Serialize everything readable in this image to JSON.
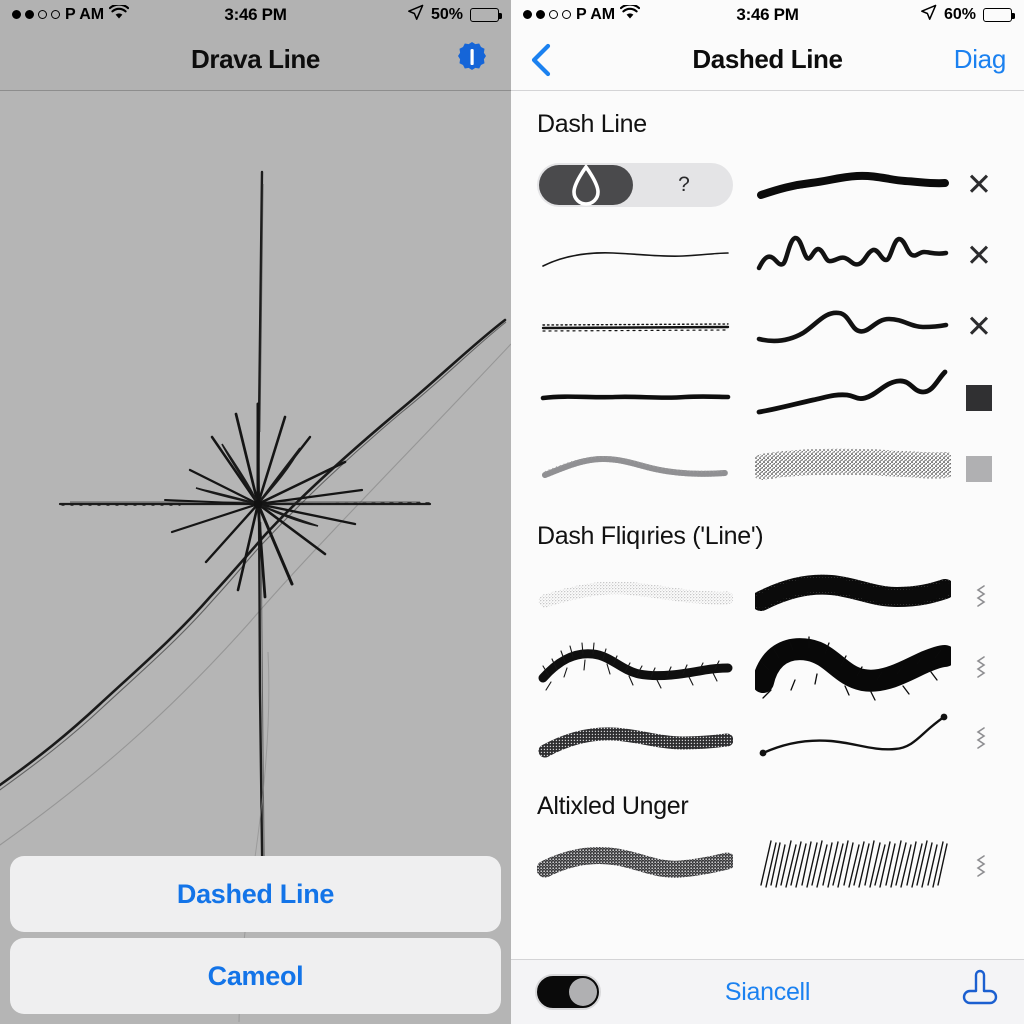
{
  "left": {
    "status_bar": {
      "signal_dots": [
        "filled",
        "filled",
        "empty",
        "empty"
      ],
      "carrier": "P AM",
      "wifi_icon": "wifi-icon",
      "time": "3:46 PM",
      "location_icon": "location-arrow-icon",
      "battery_percent": "50%",
      "battery_icon": "battery-icon"
    },
    "nav": {
      "title": "Drava Line",
      "right_icon": "info-badge-icon"
    },
    "canvas": {
      "name": "drawing-canvas",
      "background_color": "#b5b5b5",
      "description": "starburst crosshair sketch"
    },
    "actions": [
      {
        "label": "Dashed Line",
        "name": "dashed-line-button"
      },
      {
        "label": "Cameol",
        "name": "cancel-button"
      }
    ]
  },
  "right": {
    "status_bar": {
      "signal_dots": [
        "filled",
        "filled",
        "empty",
        "empty"
      ],
      "carrier": "P AM",
      "wifi_icon": "wifi-icon",
      "time": "3:46 PM",
      "location_icon": "location-arrow-icon",
      "battery_percent": "60%",
      "battery_icon": "battery-icon"
    },
    "nav": {
      "back_icon": "chevron-left-icon",
      "title": "Dashed Line",
      "action_label": "Diag"
    },
    "sections": [
      {
        "title": "Dash Line",
        "name": "section-dash-line",
        "rows": [
          {
            "left": "segmented-control",
            "right": "thick-tapered-stroke",
            "mark": "x",
            "mark_label": "✕"
          },
          {
            "left": "thin-wavy-stroke",
            "right": "jagged-zigzag-stroke",
            "mark": "x",
            "mark_label": "✕"
          },
          {
            "left": "dotted-flat-stroke",
            "right": "smooth-curve-stroke",
            "mark": "x",
            "mark_label": "✕"
          },
          {
            "left": "bold-flat-stroke",
            "right": "rising-wave-stroke",
            "mark": "swatch",
            "mark_color": "#303032"
          },
          {
            "left": "light-textured-stroke",
            "right": "spray-dots-stroke",
            "mark": "swatch",
            "mark_color": "#b0b0b2"
          }
        ],
        "segmented_control": {
          "name": "brush-mode-segmented-control",
          "options": [
            {
              "label": "☁",
              "icon": "droplet-icon",
              "selected": true
            },
            {
              "label": "?",
              "icon": "question-icon",
              "selected": false
            }
          ]
        }
      },
      {
        "title": "Dash Fliqıries ('Line')",
        "name": "section-dash-figures",
        "rows": [
          {
            "left": "light-speckle-stroke",
            "right": "dense-furry-stroke",
            "mark": "squiggle"
          },
          {
            "left": "bristle-brush-stroke",
            "right": "heavy-fur-stroke",
            "mark": "squiggle"
          },
          {
            "left": "grainy-ribbon-stroke",
            "right": "thin-dotted-endpoint-stroke",
            "mark": "squiggle"
          }
        ]
      },
      {
        "title": "Altixled Unger",
        "name": "section-altixled-unger",
        "rows": [
          {
            "left": "coarse-grain-stroke",
            "right": "hatched-scribble-stroke",
            "mark": "squiggle"
          }
        ]
      }
    ],
    "toolbar": {
      "toggle": {
        "name": "mode-toggle",
        "on": true
      },
      "label": "Siancell",
      "right_icon": "stamp-tool-icon"
    }
  },
  "colors": {
    "accent_blue": "#1b81f0",
    "button_blue": "#1374e8",
    "canvas_gray": "#b5b5b5",
    "panel_bg": "#fbfbfb",
    "dark_swatch": "#303032",
    "light_swatch": "#b0b0b2"
  }
}
